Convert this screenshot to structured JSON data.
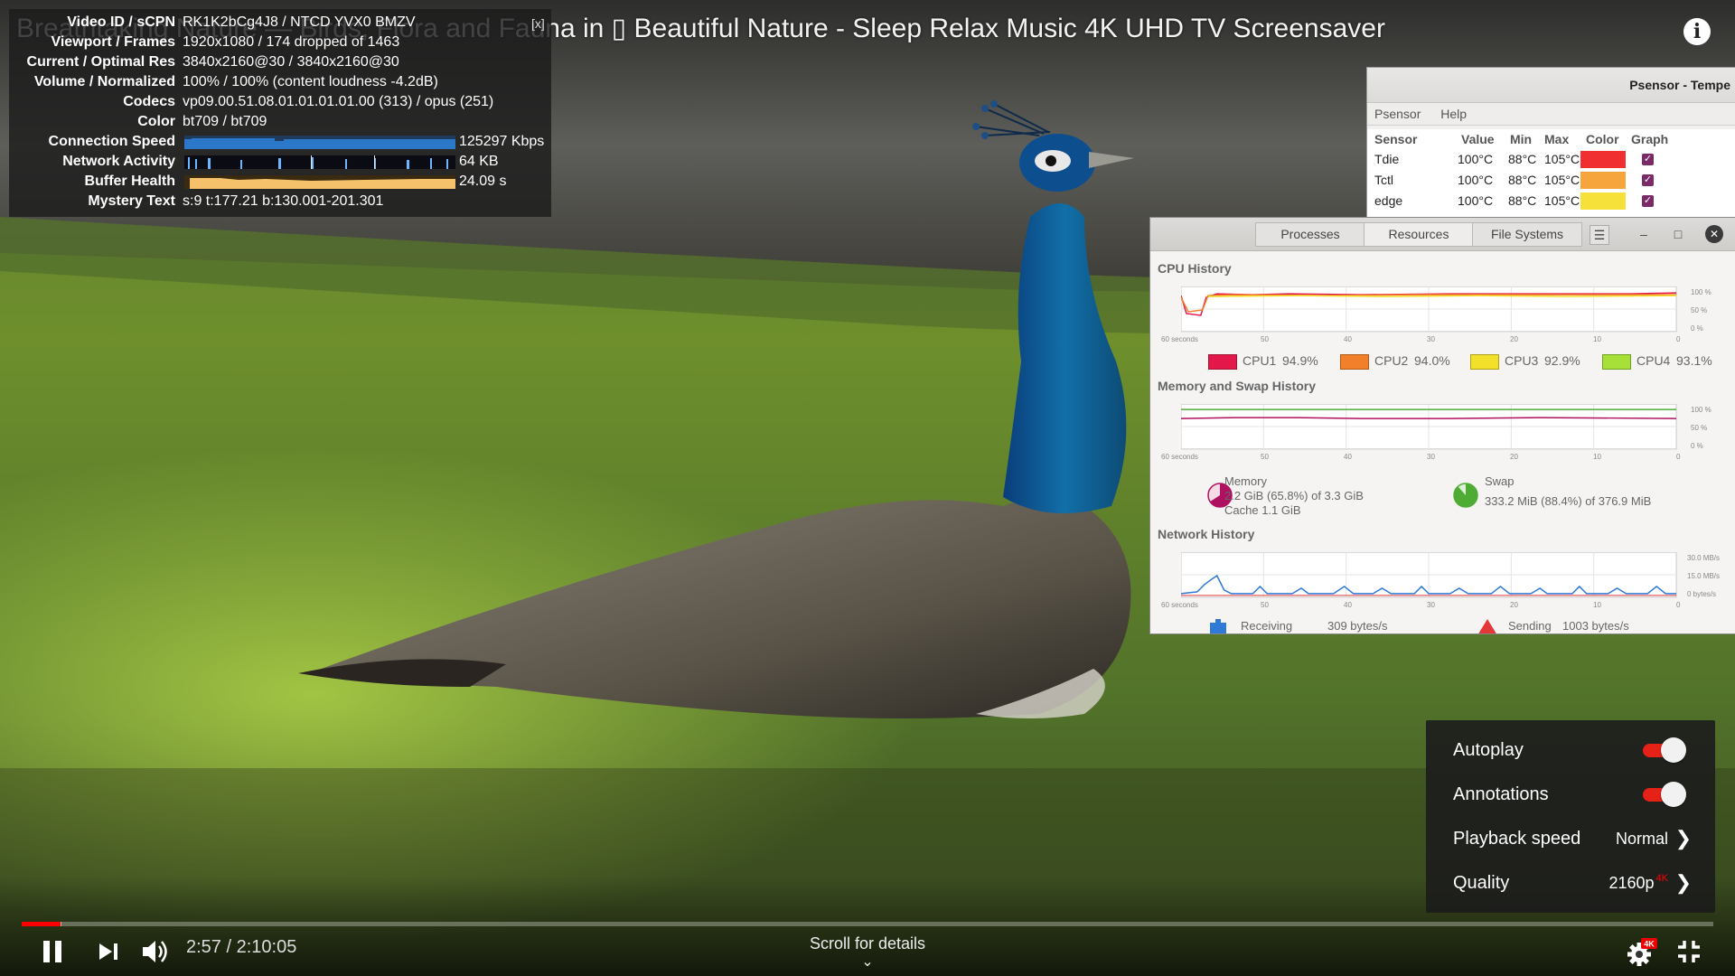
{
  "video": {
    "title": "Breathtaking Nature — Relax with Birds, Flora and Fauna — Beautiful Nature - Sleep Relax Music 4K UHD TV Screensaver",
    "title_visible": "Breathtaking Nature — Birds, Flora and Fauna in ▯ Beautiful Nature - Sleep Relax Music 4K UHD TV Screensaver"
  },
  "stats": {
    "close_label": "[x]",
    "rows": [
      {
        "key": "Video ID / sCPN",
        "value": "RK1K2bCg4J8 / NTCD YVX0 BMZV"
      },
      {
        "key": "Viewport / Frames",
        "value": "1920x1080 / 174 dropped of 1463"
      },
      {
        "key": "Current / Optimal Res",
        "value": "3840x2160@30 / 3840x2160@30"
      },
      {
        "key": "Volume / Normalized",
        "value": "100% / 100% (content loudness -4.2dB)"
      },
      {
        "key": "Codecs",
        "value": "vp09.00.51.08.01.01.01.01.00 (313) / opus (251)"
      },
      {
        "key": "Color",
        "value": "bt709 / bt709"
      },
      {
        "key": "Connection Speed",
        "value": "125297 Kbps"
      },
      {
        "key": "Network Activity",
        "value": "64 KB"
      },
      {
        "key": "Buffer Health",
        "value": "24.09 s"
      },
      {
        "key": "Mystery Text",
        "value": "s:9 t:177.21 b:130.001-201.301"
      }
    ]
  },
  "psensor": {
    "title": "Psensor - Tempe",
    "menu": [
      "Psensor",
      "Help"
    ],
    "headers": [
      "Sensor",
      "Value",
      "Min",
      "Max",
      "Color",
      "Graph"
    ],
    "rows": [
      {
        "sensor": "Tdie",
        "value": "100°C",
        "min": "88°C",
        "max": "105°C",
        "color": "#f03030",
        "graph": true
      },
      {
        "sensor": "Tctl",
        "value": "100°C",
        "min": "88°C",
        "max": "105°C",
        "color": "#f6a53c",
        "graph": true
      },
      {
        "sensor": "edge",
        "value": "100°C",
        "min": "88°C",
        "max": "105°C",
        "color": "#f6e13a",
        "graph": true
      }
    ]
  },
  "sysmon": {
    "tabs": [
      "Processes",
      "Resources",
      "File Systems"
    ],
    "selected_tab": "Resources",
    "window_controls": [
      "☰",
      "–",
      "□",
      "✕"
    ],
    "cpu": {
      "heading": "CPU History",
      "y_ticks": [
        "100 %",
        "50 %",
        "0 %"
      ],
      "x_ticks": [
        "60 seconds",
        "50",
        "40",
        "30",
        "20",
        "10",
        "0"
      ],
      "legend": [
        {
          "label": "CPU1",
          "value": "94.9%",
          "color": "#e4174a"
        },
        {
          "label": "CPU2",
          "value": "94.0%",
          "color": "#f27f2a"
        },
        {
          "label": "CPU3",
          "value": "92.9%",
          "color": "#f3e02a"
        },
        {
          "label": "CPU4",
          "value": "93.1%",
          "color": "#a8e03a"
        }
      ]
    },
    "memory": {
      "heading": "Memory and Swap History",
      "y_ticks": [
        "100 %",
        "50 %",
        "0 %"
      ],
      "x_ticks": [
        "60 seconds",
        "50",
        "40",
        "30",
        "20",
        "10",
        "0"
      ],
      "memory_label": "Memory",
      "memory_value": "2.2 GiB (65.8%) of 3.3 GiB",
      "cache_value": "Cache 1.1 GiB",
      "memory_fraction": 0.658,
      "memory_color": "#b01060",
      "swap_label": "Swap",
      "swap_value": "333.2 MiB (88.4%) of 376.9 MiB",
      "swap_fraction": 0.884,
      "swap_color": "#4eac35"
    },
    "network": {
      "heading": "Network History",
      "y_ticks": [
        "30.0 MB/s",
        "15.0 MB/s",
        "0 bytes/s"
      ],
      "x_ticks": [
        "60 seconds",
        "50",
        "40",
        "30",
        "20",
        "10",
        "0"
      ],
      "receiving_label": "Receiving",
      "receiving_value": "309 bytes/s",
      "sending_label": "Sending",
      "sending_value": "1003 bytes/s",
      "receiving_color": "#2f7ad6",
      "sending_color": "#e23838"
    }
  },
  "settings": {
    "autoplay_label": "Autoplay",
    "autoplay_on": true,
    "annotations_label": "Annotations",
    "annotations_on": true,
    "speed_label": "Playback speed",
    "speed_value": "Normal",
    "quality_label": "Quality",
    "quality_value": "2160p",
    "quality_badge": "4K"
  },
  "player": {
    "current_time": "2:57",
    "duration": "2:10:05",
    "time_display": "2:57 / 2:10:05",
    "played_fraction": 0.023,
    "buffered_fraction": 0.0235,
    "scroll_hint": "Scroll for details",
    "gear_badge": "4K",
    "accent_color": "#ff0000"
  }
}
